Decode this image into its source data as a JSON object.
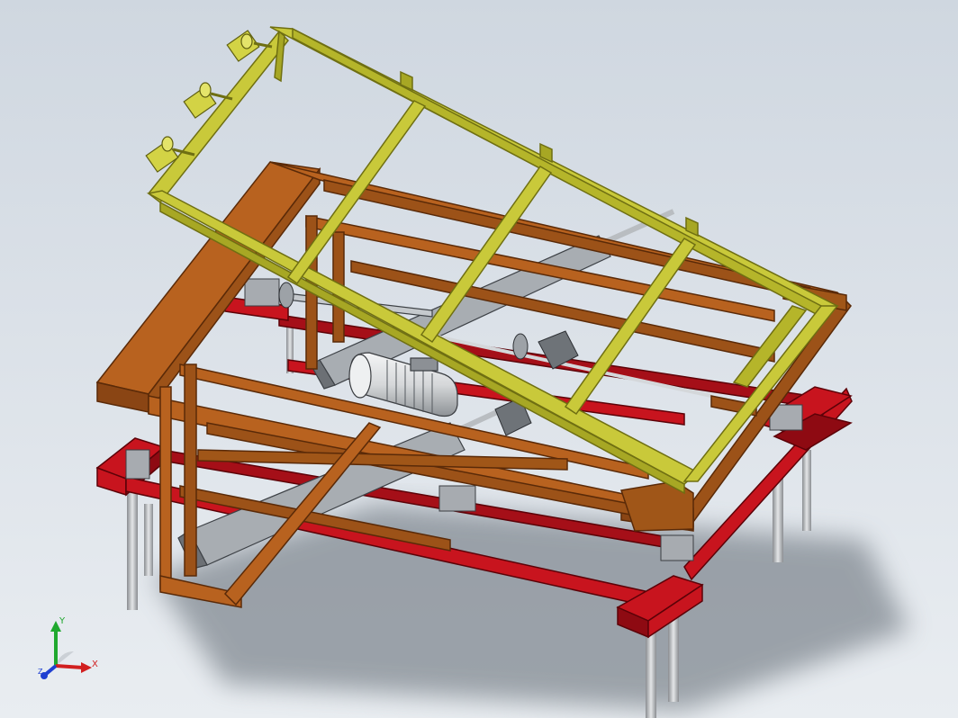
{
  "viewport": {
    "background_top": "#cfd7e0",
    "background_bottom": "#e9edf1"
  },
  "model": {
    "colors": {
      "tilt_frame": "#c9c93a",
      "tilt_frame_edge": "#6f6f12",
      "mid_frame": "#b8621f",
      "mid_frame_edge": "#5a2a08",
      "base_frame": "#c8141e",
      "base_frame_edge": "#5c0208",
      "legs": "#c4c7cb",
      "motor": "#dfe1e3",
      "actuator": "#9ea3a8"
    }
  },
  "triad": {
    "x_label": "X",
    "y_label": "Y",
    "z_label": "Z",
    "x_color": "#d11f1f",
    "y_color": "#1fa82e",
    "z_color": "#1f3fd1"
  }
}
